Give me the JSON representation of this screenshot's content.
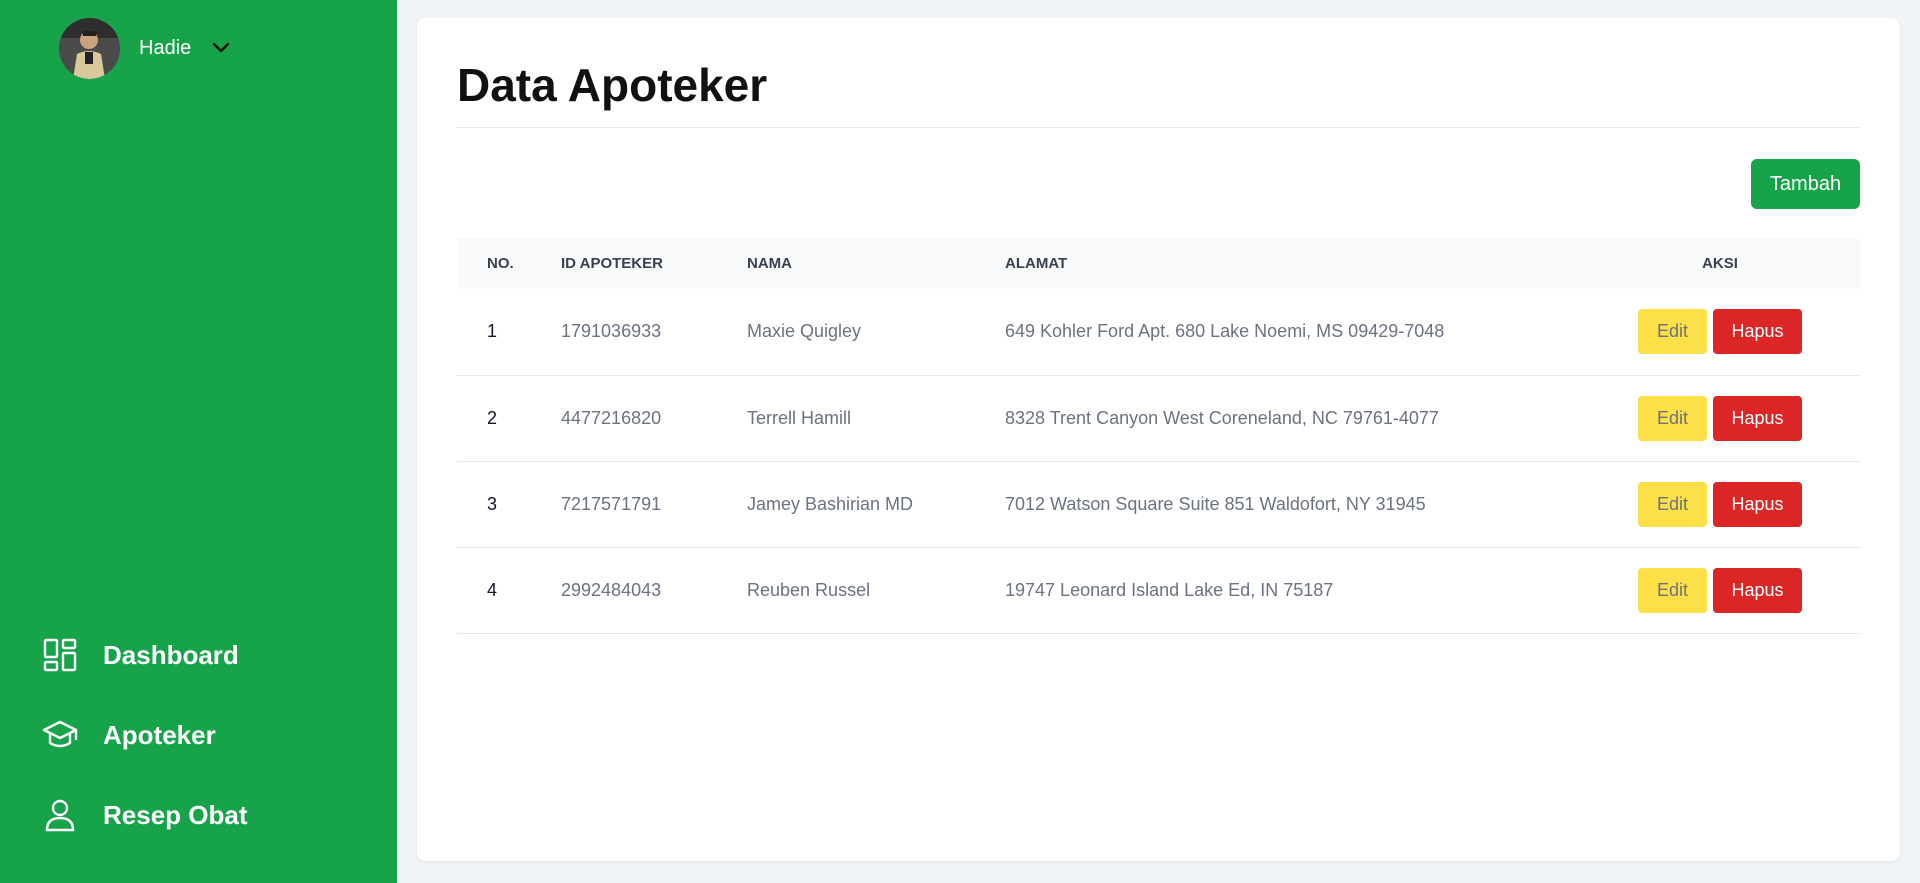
{
  "user": {
    "name": "Hadie"
  },
  "nav": {
    "items": [
      {
        "label": "Dashboard",
        "icon": "dashboard-icon"
      },
      {
        "label": "Apoteker",
        "icon": "graduation-cap-icon"
      },
      {
        "label": "Resep Obat",
        "icon": "user-icon"
      }
    ]
  },
  "page": {
    "title": "Data Apoteker",
    "add_label": "Tambah"
  },
  "table": {
    "headers": {
      "no": "NO.",
      "id": "ID APOTEKER",
      "nama": "NAMA",
      "alamat": "ALAMAT",
      "aksi": "AKSI"
    },
    "edit_label": "Edit",
    "delete_label": "Hapus",
    "rows": [
      {
        "no": "1",
        "id": "1791036933",
        "nama": "Maxie Quigley",
        "alamat": "649 Kohler Ford Apt. 680 Lake Noemi, MS 09429-7048"
      },
      {
        "no": "2",
        "id": "4477216820",
        "nama": "Terrell Hamill",
        "alamat": "8328 Trent Canyon West Coreneland, NC 79761-4077"
      },
      {
        "no": "3",
        "id": "7217571791",
        "nama": "Jamey Bashirian MD",
        "alamat": "7012 Watson Square Suite 851 Waldofort, NY 31945"
      },
      {
        "no": "4",
        "id": "2992484043",
        "nama": "Reuben Russel",
        "alamat": "19747 Leonard Island Lake Ed, IN 75187"
      }
    ]
  },
  "colors": {
    "sidebar": "#16a34a",
    "primary_button": "#16a34a",
    "edit_button": "#fde047",
    "delete_button": "#dc2626"
  }
}
